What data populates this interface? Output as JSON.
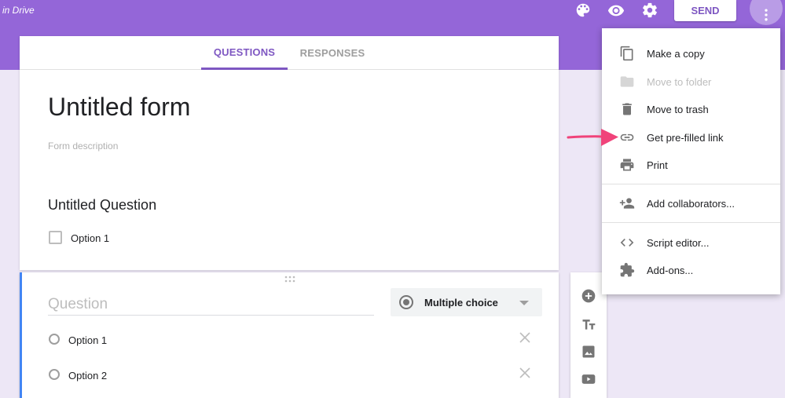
{
  "topbar": {
    "drive_label": "in Drive",
    "send_label": "SEND",
    "icons": [
      "palette-icon",
      "eye-icon",
      "gear-icon",
      "more-vert-icon"
    ]
  },
  "tabs": {
    "questions": "QUESTIONS",
    "responses": "RESPONSES"
  },
  "form": {
    "title": "Untitled form",
    "description_placeholder": "Form description"
  },
  "question1": {
    "title": "Untitled Question",
    "option": "Option 1"
  },
  "question2": {
    "placeholder": "Question",
    "type": "Multiple choice",
    "options": [
      "Option 1",
      "Option 2"
    ]
  },
  "menu": {
    "items": [
      {
        "label": "Make a copy",
        "icon": "copy-icon"
      },
      {
        "label": "Move to folder",
        "icon": "folder-icon",
        "disabled": true
      },
      {
        "label": "Move to trash",
        "icon": "trash-icon"
      },
      {
        "label": "Get pre-filled link",
        "icon": "link-icon"
      },
      {
        "label": "Print",
        "icon": "print-icon"
      },
      {
        "label": "Add collaborators...",
        "icon": "add-people-icon"
      },
      {
        "label": "Script editor...",
        "icon": "code-icon"
      },
      {
        "label": "Add-ons...",
        "icon": "puzzle-icon"
      }
    ]
  },
  "colors": {
    "topbar": "#9466d8",
    "accent": "#7e57c2",
    "background": "#ede7f6",
    "arrow": "#f0437a",
    "focus_bar": "#4285f4"
  }
}
